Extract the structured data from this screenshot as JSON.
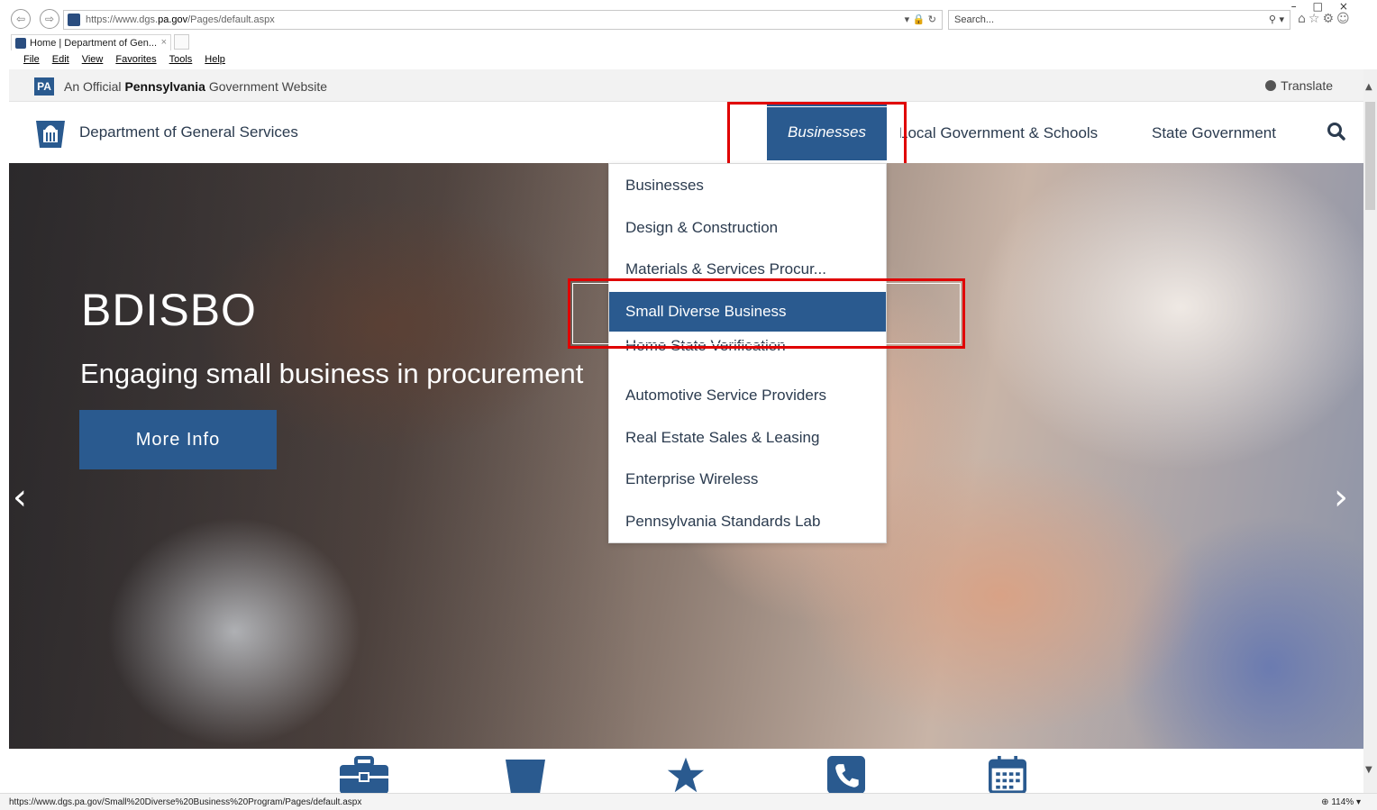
{
  "browser": {
    "url_prefix": "https://www.dgs.",
    "url_domain": "pa.gov",
    "url_suffix": "/Pages/default.aspx",
    "search_placeholder": "Search...",
    "tab_title": "Home | Department of Gen...",
    "tab_close": "×",
    "menu": [
      "File",
      "Edit",
      "View",
      "Favorites",
      "Tools",
      "Help"
    ],
    "status_url": "https://www.dgs.pa.gov/Small%20Diverse%20Business%20Program/Pages/default.aspx",
    "zoom": "114%"
  },
  "official": {
    "badge": "PA",
    "prefix": "An Official",
    "state": "Pennsylvania",
    "suffix": "Government Website",
    "translate": "Translate"
  },
  "header": {
    "dept_name": "Department of General Services",
    "nav": {
      "businesses": "Businesses",
      "local": "Local Government & Schools",
      "state": "State Government"
    }
  },
  "hero": {
    "title": "BDISBO",
    "subtitle": "Engaging small business in procurement",
    "button": "More Info",
    "prev": "‹",
    "next": "›"
  },
  "dropdown": {
    "items": [
      "Businesses",
      "Design & Construction",
      "Materials & Services Procur...",
      "Small Diverse Business",
      "Home State Verification",
      "Automotive Service Providers",
      "Real Estate Sales & Leasing",
      "Enterprise Wireless",
      "Pennsylvania Standards Lab"
    ],
    "active": "Small Diverse Business"
  },
  "icons": {
    "strip": [
      "briefcase-icon",
      "keystone-icon",
      "star-icon",
      "phone-icon",
      "calendar-icon"
    ],
    "brand_color": "#2a5a8f",
    "highlight_color": "#e00000"
  }
}
